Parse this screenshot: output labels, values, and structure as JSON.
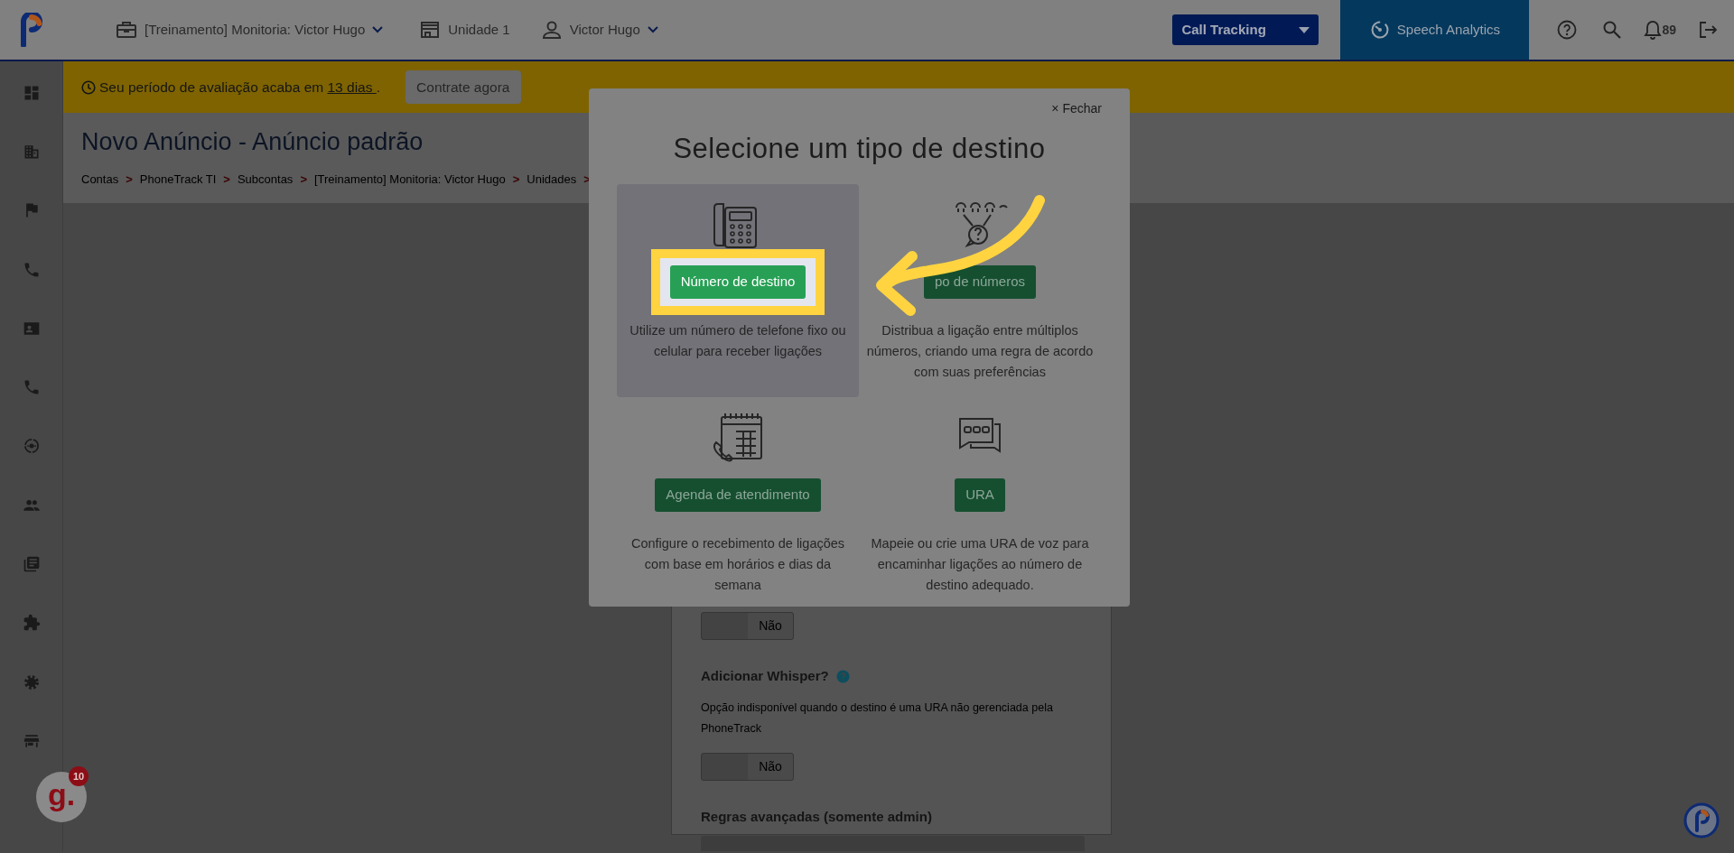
{
  "topbar": {
    "account": "[Treinamento] Monitoria: Victor Hugo",
    "unit": "Unidade 1",
    "user": "Victor Hugo",
    "product_select": "Call Tracking",
    "speech_analytics": "Speech Analytics",
    "notifications": "89"
  },
  "sidebar": {
    "items": [
      {
        "kind": "dashboard"
      },
      {
        "kind": "building"
      },
      {
        "kind": "flag"
      },
      {
        "kind": "phone"
      },
      {
        "kind": "contact"
      },
      {
        "kind": "phone"
      },
      {
        "kind": "target"
      },
      {
        "kind": "people"
      },
      {
        "kind": "library"
      },
      {
        "kind": "puzzle"
      },
      {
        "kind": "settings"
      },
      {
        "kind": "store"
      }
    ]
  },
  "banner": {
    "text": "Seu período de avaliação acaba em",
    "link": "13 dias",
    "text_after": ".",
    "button": "Contrate agora"
  },
  "page": {
    "title": "Novo Anúncio - Anúncio padrão",
    "separator": ">",
    "breadcrumb": [
      "Contas",
      "PhoneTrack TI",
      "Subcontas",
      "[Treinamento] Monitoria: Victor Hugo",
      "Unidades"
    ]
  },
  "form": {
    "fields": [
      {
        "kind": "toggle",
        "on": false,
        "value": "Não"
      },
      {
        "kind": "label",
        "text": "Adicionar Whisper?",
        "help": true
      },
      {
        "kind": "hint",
        "text": "Opção indisponível quando o destino é uma URA não gerenciada pela PhoneTrack"
      },
      {
        "kind": "toggle",
        "on": false,
        "value": "Não"
      },
      {
        "kind": "label",
        "text": "Regras avançadas (somente admin)"
      },
      {
        "kind": "textarea"
      }
    ]
  },
  "modal": {
    "close": "× Fechar",
    "title": "Selecione um tipo de destino",
    "options": [
      {
        "kind": "desk-phone",
        "button": "Número de destino",
        "description": "Utilize um número de telefone fixo ou celular para receber ligações",
        "selected": true,
        "highlighted": true
      },
      {
        "kind": "group",
        "button": "po de números",
        "description": "Distribua a ligação entre múltiplos números, criando uma regra de acordo com suas preferências",
        "selected": false,
        "highlighted": false
      },
      {
        "kind": "schedule",
        "button": "Agenda de atendimento",
        "description": "Configure o recebimento de ligações com base em horários e dias da semana",
        "selected": false,
        "highlighted": false
      },
      {
        "kind": "ivr",
        "button": "URA",
        "description": "Mapeie ou crie uma URA de voz para encaminhar ligações ao número de destino adequado.",
        "selected": false,
        "highlighted": false
      }
    ]
  },
  "help_widget": {
    "label": "g.",
    "count": "10"
  }
}
